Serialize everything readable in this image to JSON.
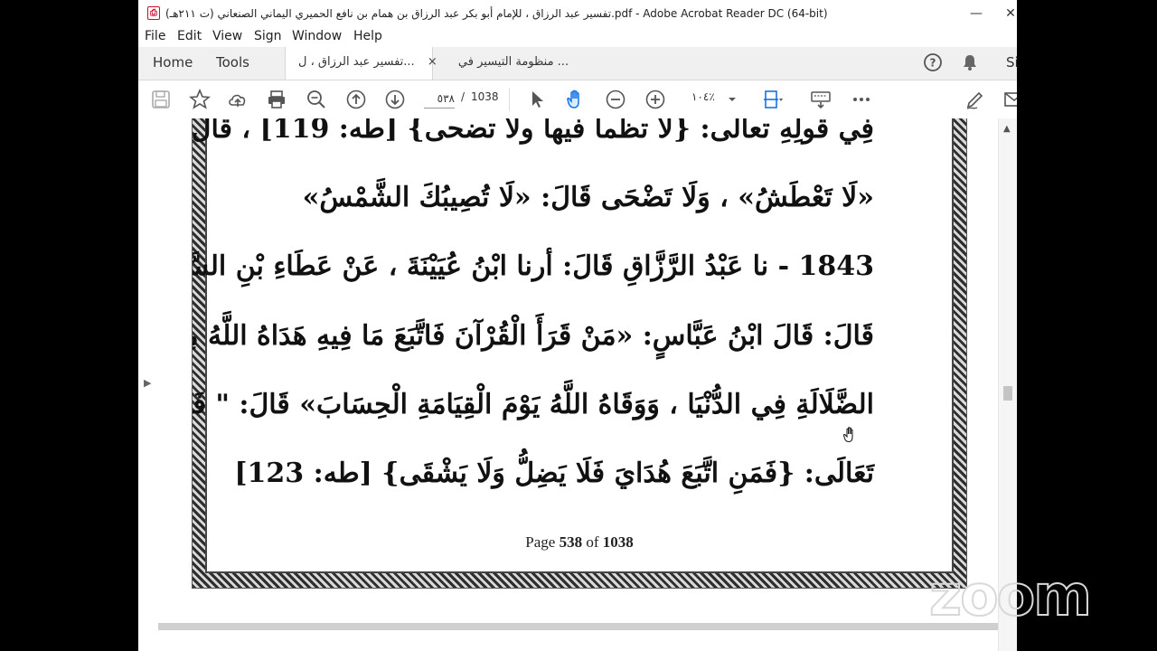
{
  "window": {
    "title": "تفسير عبد الرزاق ، للإمام أبو بكر عبد الرزاق بن همام بن نافع الحميري اليماني الصنعاني (ت ٢١١هـ).pdf - Adobe Acrobat Reader DC (64-bit)",
    "minimize": "—",
    "close": "✕"
  },
  "menu": [
    "File",
    "Edit",
    "View",
    "Sign",
    "Window",
    "Help"
  ],
  "tabs": {
    "home": "Home",
    "tools": "Tools",
    "documents": [
      {
        "label": "تفسير عبد الرزاق ، ل...",
        "active": true,
        "close": "×"
      },
      {
        "label": "منظومة التيسير في ...",
        "active": false
      }
    ],
    "sign_in": "Si"
  },
  "toolbar": {
    "current_page": "٥٣٨",
    "separator": "/",
    "total_pages": "1038",
    "zoom": "١٠٤٪"
  },
  "document": {
    "lines": [
      "فِي قولِهِ تعالى: {لا تظمأ فيها ولا تضحى} [طه: 119] ، قال: لا تظمأ:",
      "«لَا تَعْطَشُ» ، وَلَا تَضْحَى قَالَ: «لَا تُصِيبُكَ الشَّمْسُ»",
      "1843 - نا عَبْدُ الرَّزَّاقِ قَالَ: أرنا ابْنُ عُيَيْنَةَ ، عَنْ عَطَاءِ بْنِ السَّايِبِ",
      "قَالَ: قَالَ ابْنُ عَبَّاسٍ: «مَنْ قَرَأَ الْقُرْآنَ فَاتَّبَعَ مَا فِيهِ هَدَاهُ اللَّهُ مِنَ",
      "الضَّلَالَةِ فِي الدُّنْيَا ، وَوَقَاهُ اللَّهُ يَوْمَ الْقِيَامَةِ الْحِسَابَ» قَالَ: \" فَذَلِكَ قَوْلُهُ",
      "تَعَالَى: {فَمَنِ اتَّبَعَ هُدَايَ فَلَا يَضِلُّ وَلَا يَشْقَى} [طه: 123]"
    ],
    "footer": {
      "prefix": "Page",
      "page": "538",
      "of": "of",
      "total": "1038"
    }
  },
  "watermark": "zoom"
}
